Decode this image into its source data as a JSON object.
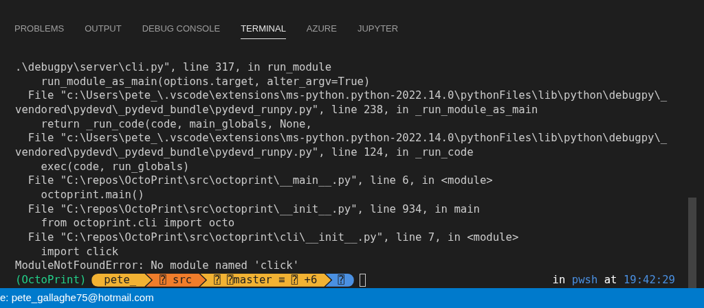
{
  "tabs": [
    {
      "label": "PROBLEMS",
      "selected": false
    },
    {
      "label": "OUTPUT",
      "selected": false
    },
    {
      "label": "DEBUG CONSOLE",
      "selected": false
    },
    {
      "label": "TERMINAL",
      "selected": true
    },
    {
      "label": "AZURE",
      "selected": false
    },
    {
      "label": "JUPYTER",
      "selected": false
    }
  ],
  "terminal": {
    "lines": [
      ".\\debugpy\\server\\cli.py\", line 317, in run_module",
      "    run_module_as_main(options.target, alter_argv=True)",
      "  File \"c:\\Users\\pete_\\.vscode\\extensions\\ms-python.python-2022.14.0\\pythonFiles\\lib\\python\\debugpy\\_",
      "vendored\\pydevd\\_pydevd_bundle\\pydevd_runpy.py\", line 238, in _run_module_as_main",
      "    return _run_code(code, main_globals, None,",
      "  File \"c:\\Users\\pete_\\.vscode\\extensions\\ms-python.python-2022.14.0\\pythonFiles\\lib\\python\\debugpy\\_",
      "vendored\\pydevd\\_pydevd_bundle\\pydevd_runpy.py\", line 124, in _run_code",
      "    exec(code, run_globals)",
      "  File \"C:\\repos\\OctoPrint\\src\\octoprint\\__main__.py\", line 6, in <module>",
      "    octoprint.main()",
      "  File \"C:\\repos\\OctoPrint\\src\\octoprint\\__init__.py\", line 934, in main",
      "    from octoprint.cli import octo",
      "  File \"C:\\repos\\OctoPrint\\src\\octoprint\\cli\\__init__.py\", line 7, in <module>",
      "    import click",
      "ModuleNotFoundError: No module named 'click'"
    ],
    "prompt": {
      "env": "(OctoPrint)",
      "segments": [
        {
          "text": "pete_",
          "color": "#f2b233"
        },
        {
          "text": "⍰ src",
          "color": "#f07d2b"
        },
        {
          "text": "⍰ ⍰master ≡ ⍰ +6",
          "color": "#f2b233"
        },
        {
          "text": "⍰",
          "color": "#4a90e2"
        }
      ],
      "right": [
        {
          "text": "in",
          "color": "#ffffff"
        },
        {
          "text": "pwsh",
          "color": "#4a90e2"
        },
        {
          "text": "at",
          "color": "#ffffff"
        },
        {
          "text": "19:42:29",
          "color": "#4a90e2"
        }
      ]
    }
  },
  "status_bar": {
    "account": "e: pete_gallaghe75@hotmail.com"
  }
}
